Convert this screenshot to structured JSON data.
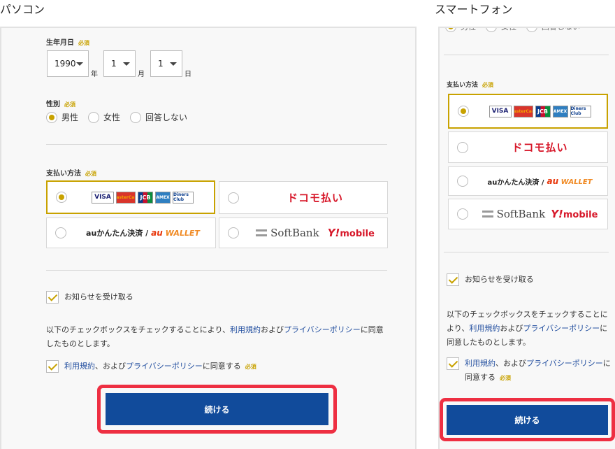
{
  "pc": {
    "title": "パソコン",
    "birth": {
      "label": "生年月日",
      "required": "必須",
      "year": "1990",
      "year_unit": "年",
      "month": "1",
      "month_unit": "月",
      "day": "1",
      "day_unit": "日"
    },
    "gender": {
      "label": "性別",
      "required": "必須",
      "options": [
        "男性",
        "女性",
        "回答しない"
      ],
      "selected": "男性"
    },
    "payment": {
      "label": "支払い方法",
      "required": "必須",
      "cards": [
        "VISA",
        "MasterCard",
        "JCB",
        "AMEX",
        "Diners Club"
      ],
      "docomo": "ドコモ払い",
      "au": "auかんたん決済 /",
      "au_wallet_au": "au",
      "au_wallet": "WALLET",
      "softbank": "SoftBank",
      "ymobile_y": "Y!",
      "ymobile": "mobile"
    },
    "newsletter": "お知らせを受け取る",
    "notice_prefix": "以下のチェックボックスをチェックすることにより、",
    "terms_link": "利用規約",
    "notice_and": "および",
    "privacy_link": "プライバシーポリシー",
    "notice_suffix": "に同意したものとします。",
    "agree_terms": "利用規約",
    "agree_mid": "、および",
    "agree_privacy": "プライバシーポリシー",
    "agree_suffix": "に同意する",
    "agree_required": "必須",
    "continue": "続ける"
  },
  "sp": {
    "title": "スマートフォン",
    "gender_options": [
      "男性",
      "女性",
      "回答しない"
    ],
    "payment": {
      "label": "支払い方法",
      "required": "必須",
      "cards": [
        "VISA",
        "MasterCard",
        "JCB",
        "AMEX",
        "Diners Club"
      ],
      "docomo": "ドコモ払い",
      "au": "auかんたん決済 /",
      "au_wallet_au": "au",
      "au_wallet": "WALLET",
      "softbank": "SoftBank",
      "ymobile_y": "Y!",
      "ymobile": "mobile"
    },
    "newsletter": "お知らせを受け取る",
    "notice_prefix": "以下のチェックボックスをチェックすることにより、",
    "terms_link": "利用規約",
    "notice_and": "および",
    "privacy_link": "プライバシーポリシー",
    "notice_suffix": "に同意したものとします。",
    "agree_terms": "利用規約",
    "agree_mid": "、および",
    "agree_privacy": "プライバシーポリシー",
    "agree_suffix": "に同意する",
    "agree_required": "必須",
    "continue": "続ける"
  },
  "colors": {
    "accent_gold": "#c8a200",
    "button_blue": "#114b9b",
    "highlight_red": "#ee2f42",
    "link_blue": "#2450a0",
    "docomo_red": "#d7182a"
  }
}
